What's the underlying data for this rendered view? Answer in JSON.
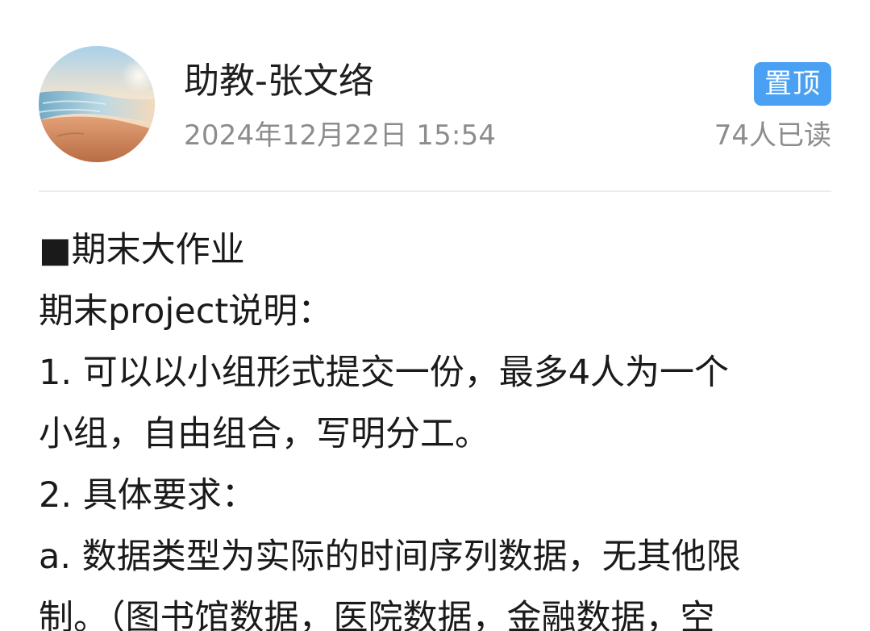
{
  "post": {
    "author": "助教-张文络",
    "datetime": "2024年12月22日 15:54",
    "pinned_label": "置顶",
    "read_count": "74人已读",
    "content_lines": [
      "■期末大作业",
      "期末project说明：",
      "1. 可以以小组形式提交一份，最多4人为一个",
      "小组，自由组合，写明分工。",
      "2. 具体要求：",
      "a. 数据类型为实际的时间序列数据，无其他限",
      "制。（图书馆数据，医院数据，金融数据，空"
    ]
  },
  "icons": {
    "avatar": "beach-sunset-avatar"
  },
  "colors": {
    "badge": "#4aa1f3",
    "secondary_text": "#8c8c8c",
    "divider": "#ececec"
  }
}
